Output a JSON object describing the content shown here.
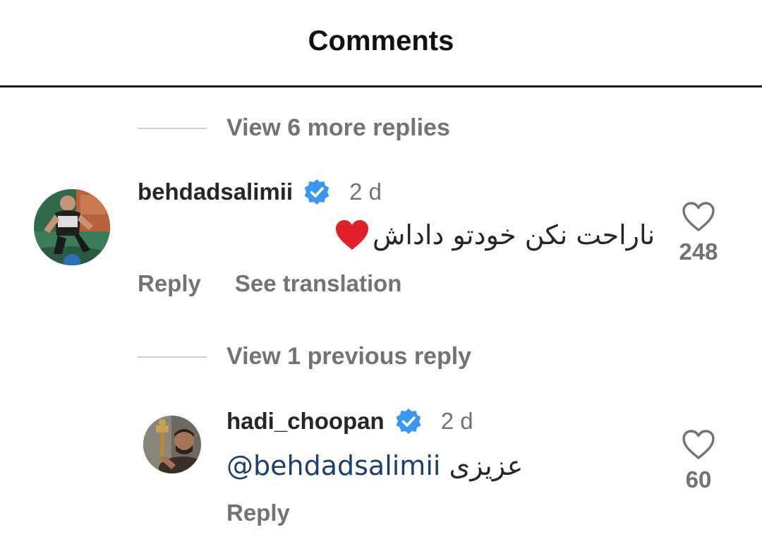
{
  "header": {
    "title": "Comments"
  },
  "threads": [
    {
      "view_replies_label": "View 6 more replies",
      "comment": {
        "username": "behdadsalimii",
        "time": "2 d",
        "text": "ناراحت نکن خودتو داداش",
        "emoji": "heart",
        "likes": "248",
        "actions": {
          "reply": "Reply",
          "translate": "See translation"
        }
      }
    },
    {
      "view_replies_label": "View 1 previous reply",
      "comment": {
        "username": "hadi_choopan",
        "time": "2 d",
        "mention": "@behdadsalimii",
        "text": "عزیزی",
        "likes": "60",
        "actions": {
          "reply": "Reply"
        }
      }
    }
  ],
  "colors": {
    "verified": "#3897f0",
    "mention": "#1d3f6e",
    "muted": "#737373",
    "heart": "#e0202a"
  },
  "icons": [
    "verified-badge-icon",
    "heart-outline-icon",
    "red-heart-emoji"
  ]
}
